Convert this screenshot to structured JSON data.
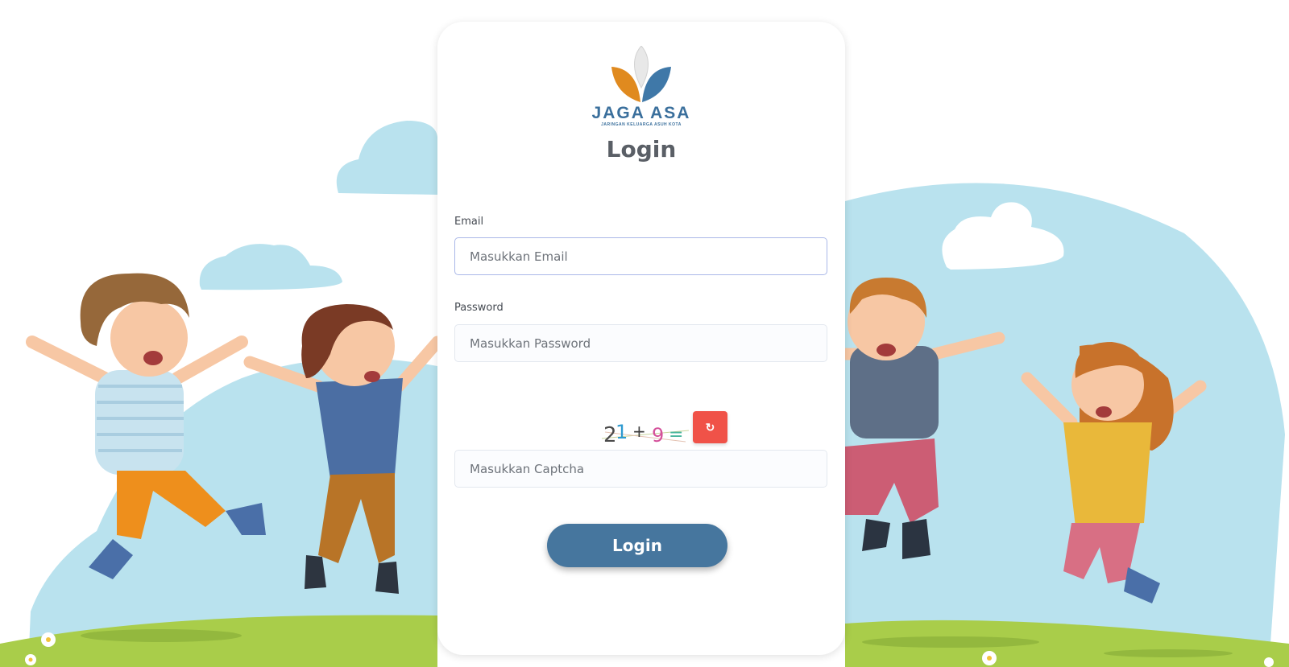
{
  "logo": {
    "name": "JAGA ASA",
    "tagline": "JARINGAN KELUARGA ASUH KOTA"
  },
  "title": "Login",
  "form": {
    "email": {
      "label": "Email",
      "placeholder": "Masukkan Email",
      "value": ""
    },
    "password": {
      "label": "Password",
      "placeholder": "Masukkan Password",
      "value": ""
    },
    "captcha": {
      "glyphs": [
        "2",
        "1",
        "+",
        "9",
        "="
      ],
      "refresh_icon": "↻",
      "placeholder": "Masukkan Captcha",
      "value": ""
    },
    "submit_label": "Login"
  },
  "colors": {
    "accent": "#46769e",
    "refresh": "#f05248",
    "sky": "#b9e2ee",
    "grass": "#a9cd4a",
    "logo_orange": "#e08a1f",
    "logo_blue": "#3f78a8"
  },
  "icons": {
    "refresh": "refresh-icon"
  }
}
